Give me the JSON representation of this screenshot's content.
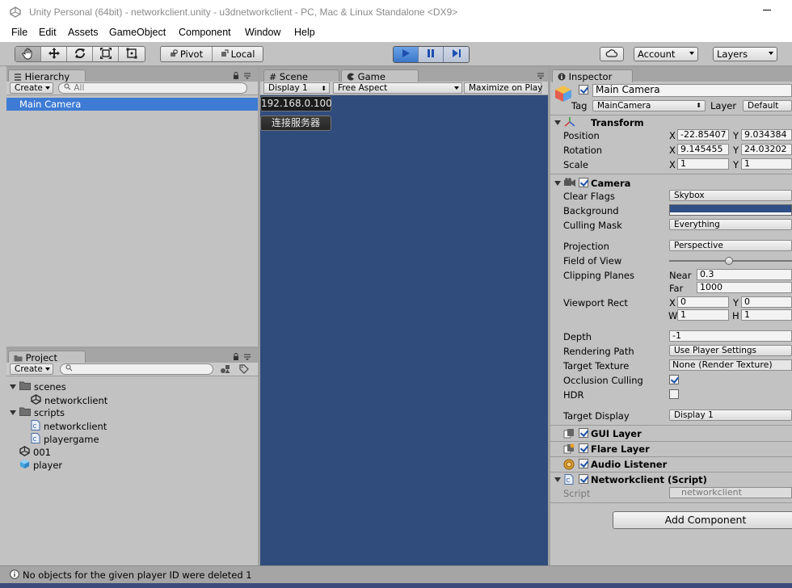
{
  "window": {
    "title": "Unity Personal (64bit) - networkclient.unity - u3dnetworkclient - PC, Mac & Linux Standalone <DX9>"
  },
  "menu": [
    "File",
    "Edit",
    "Assets",
    "GameObject",
    "Component",
    "Window",
    "Help"
  ],
  "toolbar": {
    "tools": [
      "hand-icon",
      "move-icon",
      "rotate-icon",
      "scale-icon",
      "rect-icon"
    ],
    "pivot": "Pivot",
    "local": "Local",
    "play_state": "playing",
    "account": "Account",
    "layers": "Layers"
  },
  "hierarchy": {
    "tab": "Hierarchy",
    "create": "Create",
    "search_placeholder": "All",
    "items": [
      "Main Camera"
    ],
    "selected": "Main Camera"
  },
  "project": {
    "tab": "Project",
    "create": "Create",
    "items": [
      {
        "name": "scenes",
        "type": "folder"
      },
      {
        "name": "networkclient",
        "type": "scene"
      },
      {
        "name": "scripts",
        "type": "folder"
      },
      {
        "name": "networkclient",
        "type": "script"
      },
      {
        "name": "playergame",
        "type": "script"
      },
      {
        "name": "001",
        "type": "scene"
      },
      {
        "name": "player",
        "type": "prefab"
      }
    ]
  },
  "views": {
    "scene_tab": "Scene",
    "game_tab": "Game",
    "display": "Display 1",
    "aspect": "Free Aspect",
    "maximize": "Maximize on Play",
    "ip_field": "192.168.0.100",
    "connect_button": "连接服务器"
  },
  "inspector": {
    "tab": "Inspector",
    "object_name": "Main Camera",
    "tag_label": "Tag",
    "tag": "MainCamera",
    "layer_label": "Layer",
    "layer": "Default",
    "transform": {
      "title": "Transform",
      "position_label": "Position",
      "rotation_label": "Rotation",
      "scale_label": "Scale",
      "x_label": "X",
      "y_label": "Y",
      "position": {
        "x": "-22.85407",
        "y": "9.034384"
      },
      "rotation": {
        "x": "9.145455",
        "y": "24.03202"
      },
      "scale": {
        "x": "1",
        "y": "1"
      }
    },
    "camera": {
      "title": "Camera",
      "clear_flags_label": "Clear Flags",
      "clear_flags": "Skybox",
      "background_label": "Background",
      "background_color": "#2f4f86",
      "culling_mask_label": "Culling Mask",
      "culling_mask": "Everything",
      "projection_label": "Projection",
      "projection": "Perspective",
      "fov_label": "Field of View",
      "fov_slider_fraction": 0.49,
      "clipping_label": "Clipping Planes",
      "near_label": "Near",
      "near": "0.3",
      "far_label": "Far",
      "far": "1000",
      "viewport_label": "Viewport Rect",
      "w_label": "W",
      "h_label": "H",
      "viewport": {
        "x": "0",
        "y": "0",
        "w": "1",
        "h": "1"
      },
      "depth_label": "Depth",
      "depth": "-1",
      "rendering_path_label": "Rendering Path",
      "rendering_path": "Use Player Settings",
      "target_texture_label": "Target Texture",
      "target_texture": "None (Render Texture)",
      "occlusion_label": "Occlusion Culling",
      "occlusion": true,
      "hdr_label": "HDR",
      "hdr": false,
      "target_display_label": "Target Display",
      "target_display": "Display 1"
    },
    "components": [
      "GUI Layer",
      "Flare Layer",
      "Audio Listener",
      "Networkclient (Script)"
    ],
    "script_label": "Script",
    "script": "networkclient",
    "add_component": "Add Component"
  },
  "status": {
    "message": "No objects for the given player ID were deleted 1"
  }
}
